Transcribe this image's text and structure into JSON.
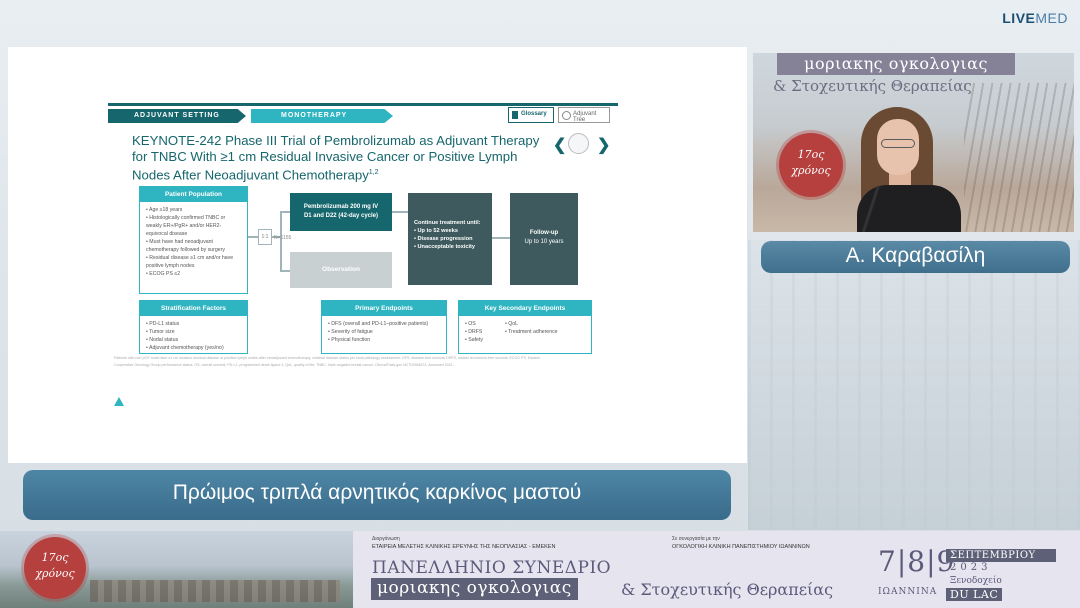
{
  "brand": {
    "live": "LIVE",
    "med": "MED"
  },
  "slide": {
    "tabs": {
      "adjuvant": "ADJUVANT SETTING",
      "mono": "MONOTHERAPY"
    },
    "buttons": {
      "glossary": "Glossary",
      "adjuvant_tree": "Adjuvant Tree"
    },
    "title": "KEYNOTE-242 Phase III Trial of Pembrolizumab as Adjuvant Therapy for TNBC With ≥1 cm Residual Invasive Cancer or Positive Lymph Nodes After Neoadjuvant Chemotherapy",
    "title_ref": "1,2",
    "nav": {
      "prev": "❮",
      "next": "❯"
    },
    "patient_population": {
      "header": "Patient Population",
      "items": [
        "Age ≥18 years",
        "Histologically confirmed TNBC or weakly ER+/PgR+ and/or HER2-equivocal disease",
        "Must have had neoadjuvant chemotherapy followed by surgery",
        "Residual disease ≥1 cm and/or have positive lymph nodes",
        "ECOG PS ≤2"
      ]
    },
    "stratification": {
      "header": "Stratification Factors",
      "items": [
        "PD-L1 status",
        "Tumor size",
        "Nodal status",
        "Adjuvant chemotherapy (yes/no)"
      ]
    },
    "randomization": {
      "ratio": "1:1",
      "n": "N=1155"
    },
    "pembro_arm": {
      "line1": "Pembrolizumab 200 mg IV",
      "line2": "D1 and D22 (42-day cycle)"
    },
    "observation_arm": "Observation",
    "continue_treatment": {
      "title": "Continue treatment until:",
      "items": [
        "Up to 52 weeks",
        "Disease progression",
        "Unacceptable toxicity"
      ]
    },
    "followup": {
      "line1": "Follow-up",
      "line2": "Up to 10 years"
    },
    "primary_endpoints": {
      "header": "Primary Endpoints",
      "items": [
        "DFS (overall and PD-L1–positive patients)",
        "Severity of fatigue",
        "Physical function"
      ]
    },
    "secondary_endpoints": {
      "header": "Key Secondary Endpoints",
      "col1": [
        "OS",
        "DRFS",
        "Safety"
      ],
      "col2": [
        "QoL",
        "Treatment adherence"
      ]
    },
    "footnote": "Patients with non-pCR must have ≥1 cm invasive residual disease or positive lymph nodes after neoadjuvant chemotherapy; residual disease status per local pathology assessment. DFS, disease-free survival; DRFS, distant recurrence-free survival; ECOG PS, Eastern Cooperative Oncology Group performance status; OS, overall survival; PD-L1, programmed death ligand 1; QoL, quality of life; TNBC, triple-negative breast cancer. ClinicalTrials.gov NCT02954874. Accessed 2021."
  },
  "speaker": {
    "video_banner_1": "μοριακης ογκολογιας",
    "video_banner_2": "& Στοχευτικής Θεραπείας",
    "seal_line1": "17ος",
    "seal_line2": "χρόνος",
    "name": "Α. Καραβασίλη"
  },
  "topic": "Πρώιμος τριπλά αρνητικός καρκίνος μαστού",
  "footer": {
    "seal_line1": "17ος",
    "seal_line2": "χρόνος",
    "org_label": "Διοργάνωση",
    "org_name": "ΕΤΑΙΡΕΙΑ ΜΕΛΕΤΗΣ ΚΛΙΝΙΚΗΣ ΕΡΕΥΝΗΣ ΤΗΣ ΝΕΟΠΛΑΣΙΑΣ - ΕΜΕΚΕΝ",
    "collab_label": "Σε συνεργασία με την",
    "collab_name": "ΟΓΚΟΛΟΓΙΚΗ ΚΛΙΝΙΚΗ ΠΑΝΕΠΙΣΤΗΜΙΟΥ ΙΩΑΝΝΙΝΩΝ",
    "congress_line1": "ΠΑΝΕΛΛΗΝΙΟ ΣΥΝΕΔΡΙΟ",
    "congress_line2": "μοριακης ογκολογιας",
    "congress_line3": "& Στοχευτικής Θεραπείας",
    "dates": "7|8|9",
    "month": "ΣΕΠΤΕΜΒΡΙΟΥ",
    "year": "2023",
    "city": "ΙΩΑΝΝΙΝΑ",
    "hotel": "Ξενοδοχείο",
    "venue": "DU LAC"
  }
}
